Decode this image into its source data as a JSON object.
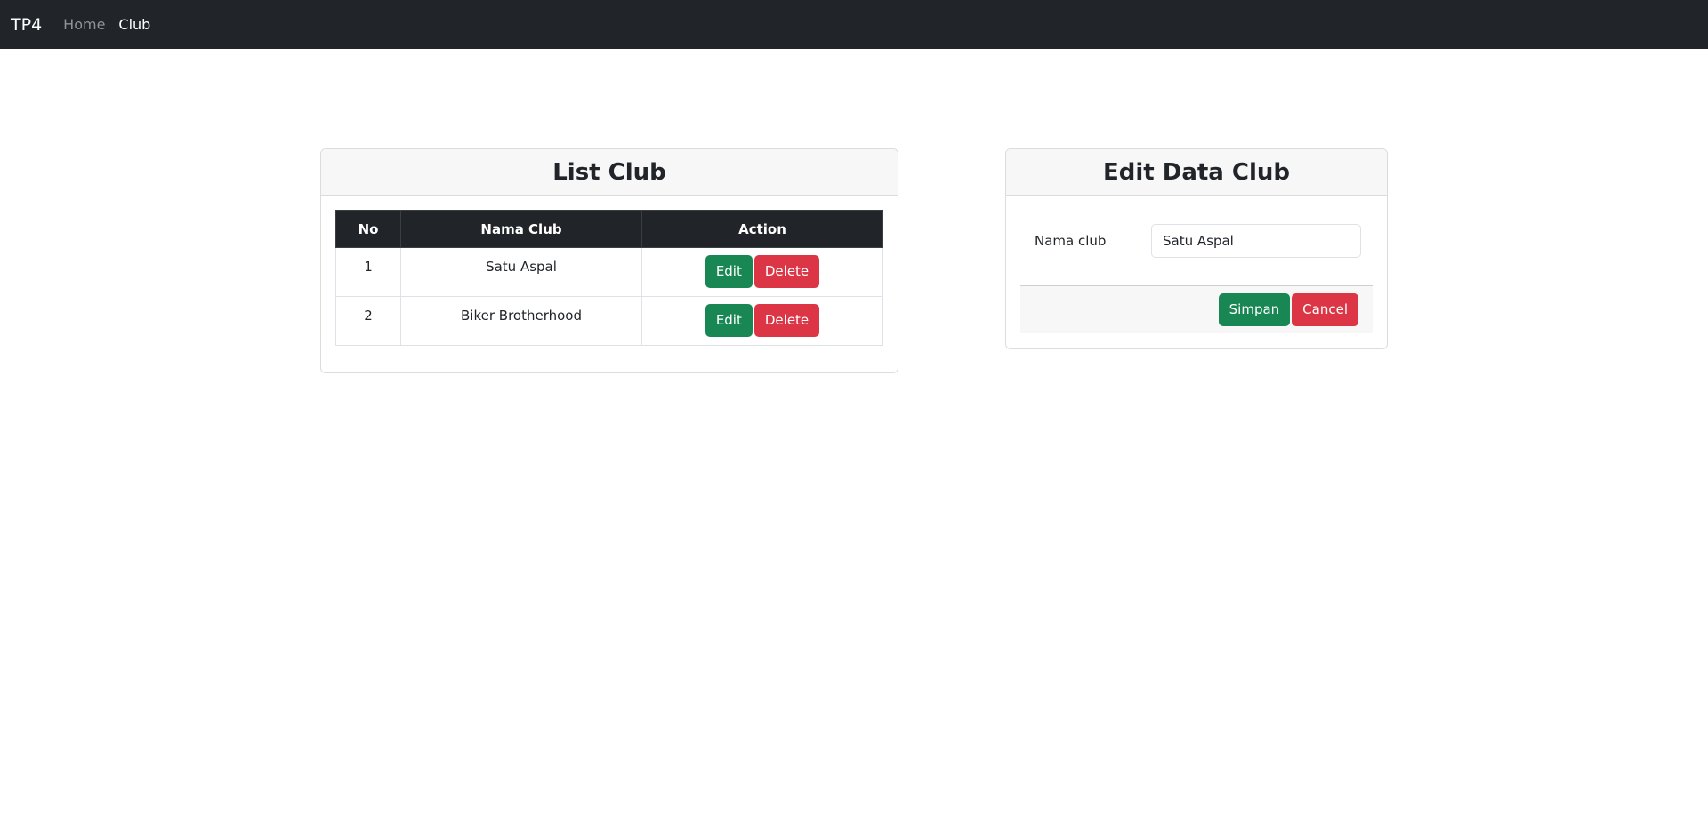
{
  "navbar": {
    "brand": "TP4",
    "links": [
      {
        "label": "Home"
      },
      {
        "label": "Club"
      }
    ]
  },
  "list_card": {
    "title": "List Club",
    "columns": [
      "No",
      "Nama Club",
      "Action"
    ],
    "rows": [
      {
        "no": "1",
        "name": "Satu Aspal",
        "edit_label": "Edit",
        "delete_label": "Delete"
      },
      {
        "no": "2",
        "name": "Biker Brotherhood",
        "edit_label": "Edit",
        "delete_label": "Delete"
      }
    ]
  },
  "edit_card": {
    "title": "Edit Data Club",
    "field_label": "Nama club",
    "field_value": "Satu Aspal",
    "save_label": "Simpan",
    "cancel_label": "Cancel"
  },
  "colors": {
    "navbar_bg": "#212529",
    "success": "#198754",
    "danger": "#dc3545"
  }
}
